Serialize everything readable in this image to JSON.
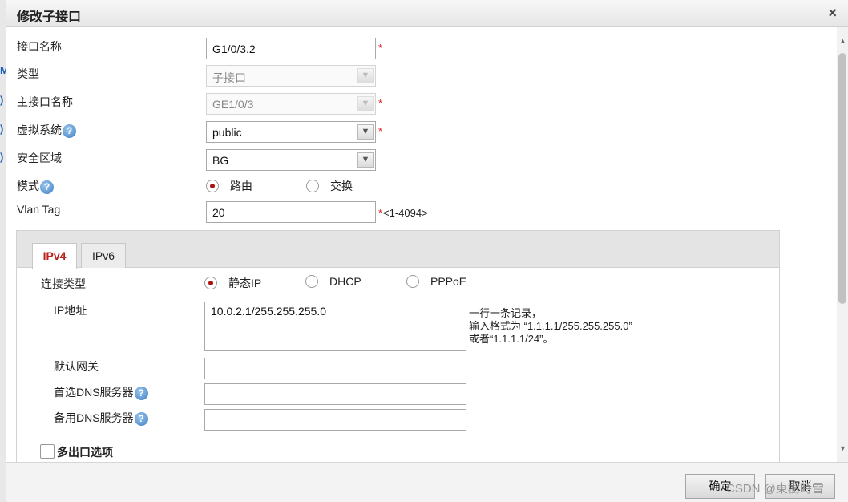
{
  "background_window": {
    "edge_glyphs": [
      "M",
      ")",
      ")",
      ")"
    ]
  },
  "dialog": {
    "title": "修改子接口",
    "close_glyph": "×"
  },
  "form": {
    "interface_name": {
      "label": "接口名称",
      "value": "G1/0/3.2",
      "required_mark": "*"
    },
    "type": {
      "label": "类型",
      "value": "子接口"
    },
    "main_interface": {
      "label": "主接口名称",
      "value": "GE1/0/3",
      "required_mark": "*"
    },
    "virtual_system": {
      "label": "虚拟系统",
      "value": "public",
      "required_mark": "*"
    },
    "security_zone": {
      "label": "安全区域",
      "value": "BG"
    },
    "mode": {
      "label": "模式",
      "options": [
        {
          "label": "路由",
          "selected": true
        },
        {
          "label": "交换",
          "selected": false
        }
      ]
    },
    "vlan_tag": {
      "label": "Vlan Tag",
      "value": "20",
      "required_mark": "*",
      "range_hint": "<1-4094>"
    }
  },
  "tabs": [
    {
      "label": "IPv4",
      "active": true
    },
    {
      "label": "IPv6",
      "active": false
    }
  ],
  "ipv4": {
    "connection_type": {
      "label": "连接类型",
      "options": [
        {
          "label": "静态IP",
          "selected": true
        },
        {
          "label": "DHCP",
          "selected": false
        },
        {
          "label": "PPPoE",
          "selected": false
        }
      ]
    },
    "ip_address": {
      "label": "IP地址",
      "value": "10.0.2.1/255.255.255.0",
      "hint_lines": [
        "一行一条记录，",
        "输入格式为 “1.1.1.1/255.255.255.0”",
        "或者“1.1.1.1/24”。"
      ]
    },
    "default_gateway": {
      "label": "默认网关",
      "value": ""
    },
    "primary_dns": {
      "label": "首选DNS服务器",
      "value": ""
    },
    "secondary_dns": {
      "label": "备用DNS服务器",
      "value": ""
    },
    "multi_egress": {
      "label": "多出口选项",
      "checked": false
    }
  },
  "footer": {
    "confirm_label": "确定",
    "cancel_label": "取消",
    "watermark": "CSDN @東樹時雪"
  },
  "icons": {
    "help": "?",
    "dropdown": "▼",
    "scroll_up": "▲",
    "scroll_down": "▼"
  },
  "colors": {
    "accent_red": "#b8201a",
    "required_red": "#dd2222",
    "help_blue": "#3d7ec2"
  }
}
